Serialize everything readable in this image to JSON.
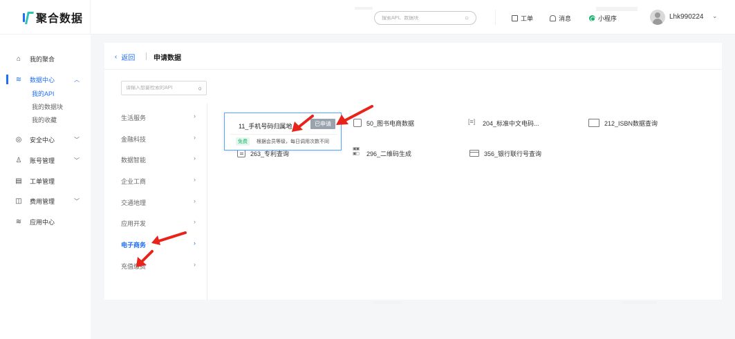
{
  "brand": {
    "name": "聚合数据"
  },
  "header": {
    "search_placeholder": "搜索API、数据块",
    "ticket": "工单",
    "messages": "消息",
    "mini_program": "小程序",
    "username": "Lhk990224"
  },
  "sidebar": {
    "items": [
      {
        "label": "我的聚合",
        "icon": "home-icon"
      },
      {
        "label": "数据中心",
        "icon": "layers-icon"
      },
      {
        "label": "安全中心",
        "icon": "shield-icon"
      },
      {
        "label": "账号管理",
        "icon": "user-icon"
      },
      {
        "label": "工单管理",
        "icon": "ticket-icon"
      },
      {
        "label": "费用管理",
        "icon": "wallet-icon"
      },
      {
        "label": "应用中心",
        "icon": "apps-icon"
      }
    ],
    "data_center_sub": [
      "我的API",
      "我的数据块",
      "我的收藏"
    ]
  },
  "page": {
    "back": "返回",
    "title": "申请数据",
    "api_search_placeholder": "请输入想要检索的API"
  },
  "categories": [
    "生活服务",
    "金融科技",
    "数据智能",
    "企业工商",
    "交通地理",
    "应用开发",
    "电子商务",
    "充值缴费"
  ],
  "active_category": "电子商务",
  "apis": [
    {
      "name": "11_手机号码归属地",
      "icon": "phone-icon"
    },
    {
      "name": "50_图书电商数据",
      "icon": "book-cart-icon"
    },
    {
      "name": "204_标准中文电码...",
      "icon": "barcode-icon"
    },
    {
      "name": "212_ISBN数据查询",
      "icon": "book-icon"
    },
    {
      "name": "263_专利查询",
      "icon": "document-icon"
    },
    {
      "name": "296_二维码生成",
      "icon": "qrcode-icon"
    },
    {
      "name": "356_银行联行号查询",
      "icon": "bank-card-icon"
    }
  ],
  "popover": {
    "title": "11_手机号码归属地",
    "apply_button": "已申请",
    "badge": "免费",
    "description": "根据会员等级，每日调用次数不同"
  },
  "colors": {
    "accent": "#1f6ef7",
    "annotation": "#e8231a",
    "free_badge": "#1ab46c"
  }
}
